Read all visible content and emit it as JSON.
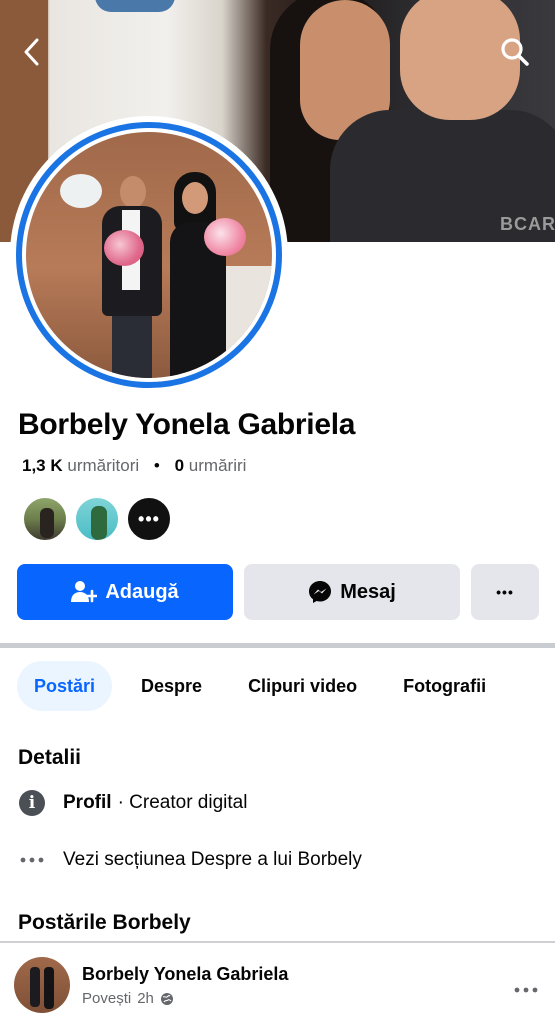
{
  "cover": {
    "shirt_text": "BCAR"
  },
  "profile": {
    "name": "Borbely Yonela Gabriela",
    "followers_count": "1,3 K",
    "followers_label": "urmăritori",
    "following_count": "0",
    "following_label": "urmăriri",
    "friends_more": "•••"
  },
  "actions": {
    "add_label": "Adaugă",
    "message_label": "Mesaj",
    "more_label": "•••"
  },
  "tabs": [
    {
      "label": "Postări",
      "active": true
    },
    {
      "label": "Despre",
      "active": false
    },
    {
      "label": "Clipuri video",
      "active": false
    },
    {
      "label": "Fotografii",
      "active": false
    }
  ],
  "details": {
    "title": "Detalii",
    "profile_type_label": "Profil",
    "profile_type_value": "· Creator digital",
    "see_about": "Vezi secțiunea Despre a lui Borbely"
  },
  "posts": {
    "title": "Postările Borbely",
    "first_post": {
      "author": "Borbely Yonela Gabriela",
      "source": "Povești",
      "time": "2h"
    }
  },
  "colors": {
    "accent": "#0866ff",
    "ring": "#1b74e4",
    "button_grey": "#e4e6eb"
  },
  "icons": [
    "back-arrow-icon",
    "search-icon",
    "add-friend-icon",
    "messenger-icon",
    "more-icon",
    "info-icon",
    "globe-icon"
  ]
}
